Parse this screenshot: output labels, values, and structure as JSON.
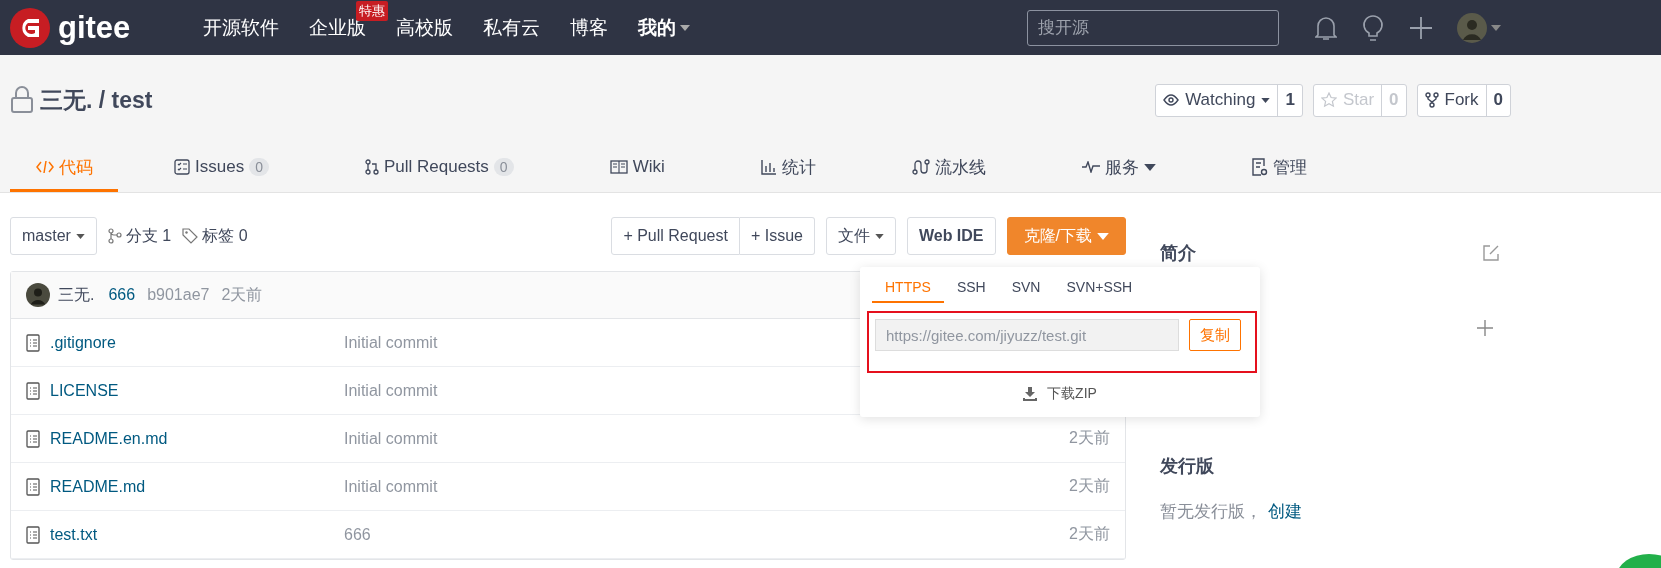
{
  "nav": {
    "logo": "gitee",
    "items": [
      {
        "label": "开源软件"
      },
      {
        "label": "企业版",
        "badge": "特惠"
      },
      {
        "label": "高校版"
      },
      {
        "label": "私有云"
      },
      {
        "label": "博客"
      },
      {
        "label": "我的",
        "caret": true
      }
    ],
    "search": {
      "placeholder": "搜开源"
    }
  },
  "repo": {
    "title": "三无. / test",
    "private": true,
    "actions": [
      {
        "kind": "watch",
        "label": "Watching",
        "count": "1",
        "caret": true,
        "disabled": false
      },
      {
        "kind": "star",
        "label": "Star",
        "count": "0",
        "caret": false,
        "disabled": true
      },
      {
        "kind": "fork",
        "label": "Fork",
        "count": "0",
        "caret": false,
        "disabled": false
      }
    ]
  },
  "tabs": [
    {
      "kind": "code",
      "label": "代码",
      "selected": true
    },
    {
      "kind": "issues",
      "label": "Issues",
      "count": "0",
      "selected": false
    },
    {
      "kind": "pr",
      "label": "Pull Requests",
      "count": "0",
      "selected": false
    },
    {
      "kind": "wiki",
      "label": "Wiki",
      "selected": false
    },
    {
      "kind": "stats",
      "label": "统计",
      "selected": false
    },
    {
      "kind": "pipeline",
      "label": "流水线",
      "selected": false
    },
    {
      "kind": "service",
      "label": "服务",
      "caret": true,
      "selected": false
    },
    {
      "kind": "manage",
      "label": "管理",
      "selected": false
    }
  ],
  "toolbar": {
    "branch": "master",
    "branches": "分支 1",
    "tags": "标签 0",
    "new_pr": "+ Pull Request",
    "new_issue": "+ Issue",
    "files": "文件",
    "web_ide": "Web IDE",
    "clone": "克隆/下载"
  },
  "commit": {
    "author": "三无.",
    "message": "666",
    "hash": "b901ae7",
    "time": "2天前"
  },
  "files": [
    {
      "name": ".gitignore",
      "message": "Initial commit"
    },
    {
      "name": "LICENSE",
      "message": "Initial commit"
    },
    {
      "name": "README.en.md",
      "message": "Initial commit",
      "time": "2天前"
    },
    {
      "name": "README.md",
      "message": "Initial commit",
      "time": "2天前"
    },
    {
      "name": "test.txt",
      "message": "666",
      "time": "2天前"
    }
  ],
  "clone": {
    "tabs": [
      {
        "label": "HTTPS",
        "selected": true
      },
      {
        "label": "SSH",
        "selected": false
      },
      {
        "label": "SVN",
        "selected": false
      },
      {
        "label": "SVN+SSH",
        "selected": false
      }
    ],
    "url": "https://gitee.com/jiyuzz/test.git",
    "copy": "复制",
    "download": "下载ZIP",
    "highlighted": true
  },
  "sidebar": {
    "about": "简介",
    "releases": "发行版",
    "no_release": "暂无发行版，",
    "create": "创建"
  }
}
